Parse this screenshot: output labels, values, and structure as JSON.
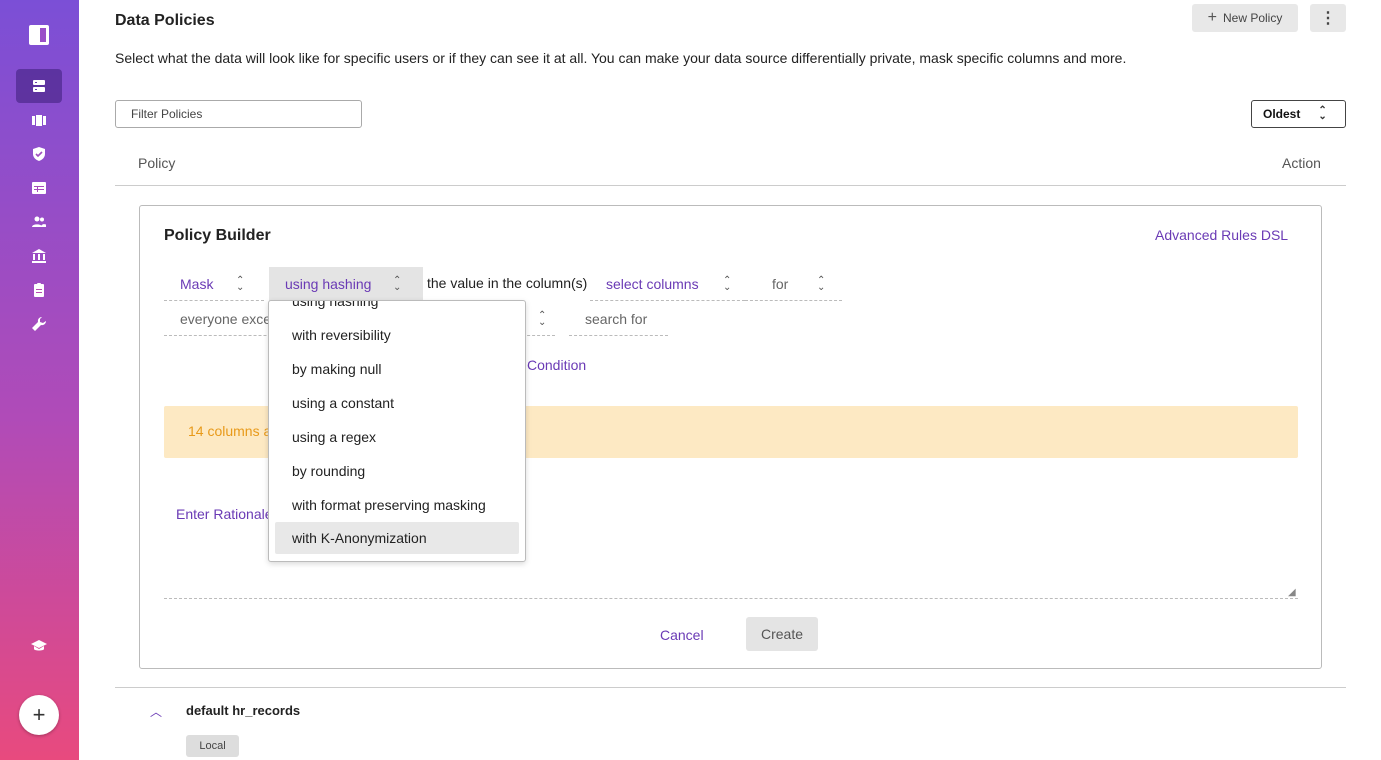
{
  "header": {
    "title": "Data Policies",
    "description": "Select what the data will look like for specific users or if they can see it at all. You can make your data source differentially private, mask specific columns and more.",
    "new_policy_label": "New Policy",
    "more_label": "⋮"
  },
  "toolbar": {
    "filter_placeholder": "Filter Policies",
    "sort_value": "Oldest"
  },
  "table": {
    "col_policy": "Policy",
    "col_action": "Action"
  },
  "builder": {
    "title": "Policy Builder",
    "advanced_link": "Advanced Rules DSL",
    "action_select": "Mask",
    "method_select": "using hashing",
    "mid_text": "the value in the column(s)",
    "columns_select": "select columns",
    "for_select": "for",
    "who_select": "everyone exce",
    "search_for": "search for",
    "condition_link": "Condition",
    "warning_text": "14 columns a",
    "rationale_link": "Enter Rationale",
    "cancel_label": "Cancel",
    "create_label": "Create"
  },
  "dropdown": {
    "options": [
      "using hashing",
      "with reversibility",
      "by making null",
      "using a constant",
      "using a regex",
      "by rounding",
      "with format preserving masking",
      "with K-Anonymization"
    ],
    "hovered": "with K-Anonymization"
  },
  "policy_row": {
    "title": "default hr_records",
    "badge": "Local"
  },
  "colors": {
    "accent": "#6a3ab5",
    "warning_bg": "#fde9c3",
    "warning_text": "#e89a1a",
    "sidebar_top": "#7b4fd6",
    "sidebar_bottom": "#e84a7e"
  }
}
